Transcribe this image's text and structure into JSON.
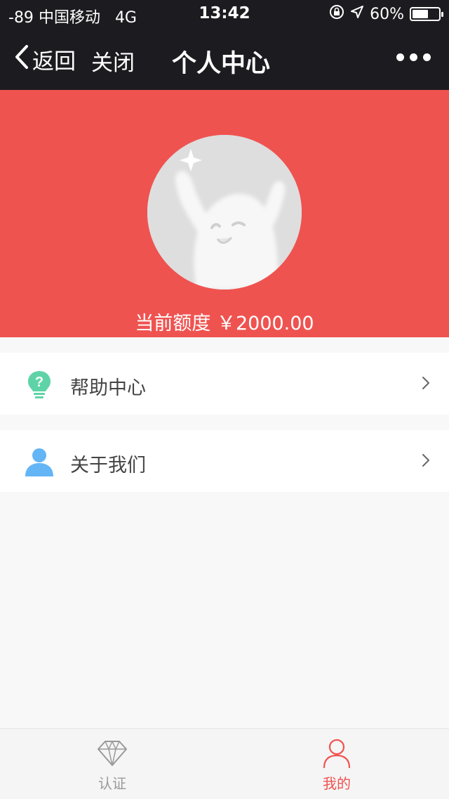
{
  "status_bar": {
    "signal": "-89",
    "carrier": "中国移动",
    "network": "4G",
    "time": "13:42",
    "battery": "60%",
    "battery_level": 0.6
  },
  "nav": {
    "back_label": "返回",
    "close_label": "关闭",
    "title": "个人中心"
  },
  "profile": {
    "credit_line": "当前额度  ￥2000.00"
  },
  "menu": {
    "items": [
      {
        "label": "帮助中心",
        "icon": "lightbulb-question-icon"
      },
      {
        "label": "关于我们",
        "icon": "user-icon"
      }
    ]
  },
  "tabs": [
    {
      "label": "认证",
      "icon": "diamond-icon",
      "active": false
    },
    {
      "label": "我的",
      "icon": "person-icon",
      "active": true
    }
  ],
  "colors": {
    "header_bg": "#1c1c20",
    "accent_red": "#ef5350",
    "help_icon_green": "#5fd3a8",
    "about_icon_blue": "#64b5f6",
    "tab_inactive": "#999999",
    "tab_active": "#ef5350"
  }
}
